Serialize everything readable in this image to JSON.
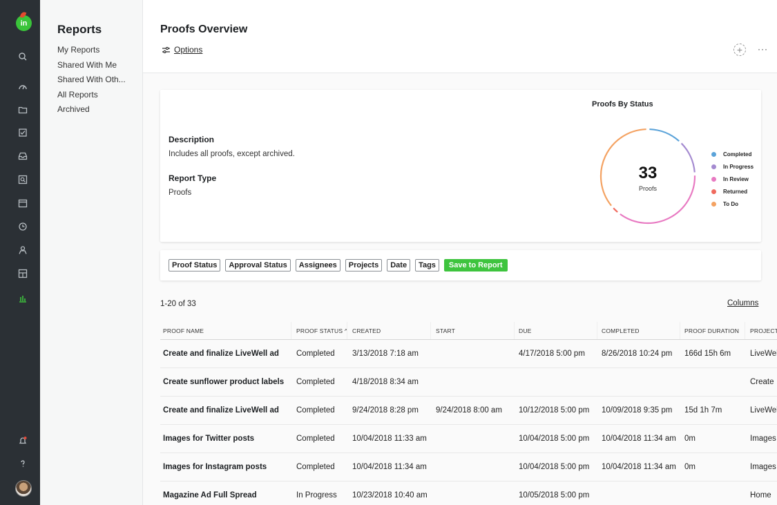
{
  "app": {
    "logo_text": "in",
    "nav_icons": [
      "search-icon",
      "dashboard-gauge-icon",
      "folder-icon",
      "checkbox-icon",
      "inbox-icon",
      "proof-search-icon",
      "calendar-icon",
      "clock-icon",
      "user-icon",
      "board-icon",
      "reports-chart-icon",
      "notification-bell-icon",
      "help-icon"
    ],
    "accent": "#3ec43e"
  },
  "sidebar": {
    "title": "Reports",
    "items": [
      "My Reports",
      "Shared With Me",
      "Shared With Oth...",
      "All Reports",
      "Archived"
    ]
  },
  "header": {
    "title": "Proofs Overview",
    "options_label": "Options",
    "add_symbol": "+",
    "more_symbol": "···"
  },
  "summary": {
    "description_label": "Description",
    "description": "Includes all proofs, except archived.",
    "report_type_label": "Report Type",
    "report_type": "Proofs"
  },
  "chart_data": {
    "type": "donut",
    "title": "Proofs By Status",
    "total": "33",
    "total_label": "Proofs",
    "segments": [
      {
        "name": "Completed",
        "value": 4,
        "color": "#5ba3d9"
      },
      {
        "name": "In Progress",
        "value": 4,
        "color": "#a48ad0"
      },
      {
        "name": "In Review",
        "value": 12,
        "color": "#e87ac2"
      },
      {
        "name": "Returned",
        "value": 1,
        "color": "#f06a5e"
      },
      {
        "name": "To Do",
        "value": 12,
        "color": "#f4a262"
      }
    ],
    "legend_position": "right"
  },
  "filters": {
    "chips": [
      "Proof Status",
      "Approval Status",
      "Assignees",
      "Projects",
      "Date",
      "Tags"
    ],
    "save_label": "Save to Report"
  },
  "table": {
    "count": "1-20 of 33",
    "columns_link": "Columns",
    "headers": [
      "PROOF NAME",
      "PROOF STATUS ^",
      "CREATED",
      "START",
      "DUE",
      "COMPLETED",
      "PROOF DURATION",
      "PROJECT"
    ],
    "rows": [
      [
        "Create and finalize LiveWell ad",
        "Completed",
        "3/13/2018 7:18 am",
        "",
        "4/17/2018 5:00 pm",
        "8/26/2018 10:24 pm",
        "166d 15h 6m",
        "LiveWell"
      ],
      [
        "Create sunflower product labels",
        "Completed",
        "4/18/2018 8:34 am",
        "",
        "",
        "",
        "",
        "Create"
      ],
      [
        "Create and finalize LiveWell ad",
        "Completed",
        "9/24/2018 8:28 pm",
        "9/24/2018 8:00 am",
        "10/12/2018 5:00 pm",
        "10/09/2018 9:35 pm",
        "15d 1h 7m",
        "LiveWell"
      ],
      [
        "Images for Twitter posts",
        "Completed",
        "10/04/2018 11:33 am",
        "",
        "10/04/2018 5:00 pm",
        "10/04/2018 11:34 am",
        "0m",
        "Images"
      ],
      [
        "Images for Instagram posts",
        "Completed",
        "10/04/2018 11:34 am",
        "",
        "10/04/2018 5:00 pm",
        "10/04/2018 11:34 am",
        "0m",
        "Images"
      ],
      [
        "Magazine Ad Full Spread",
        "In Progress",
        "10/23/2018 10:40 am",
        "",
        "10/05/2018 5:00 pm",
        "",
        "",
        "Home"
      ]
    ]
  }
}
